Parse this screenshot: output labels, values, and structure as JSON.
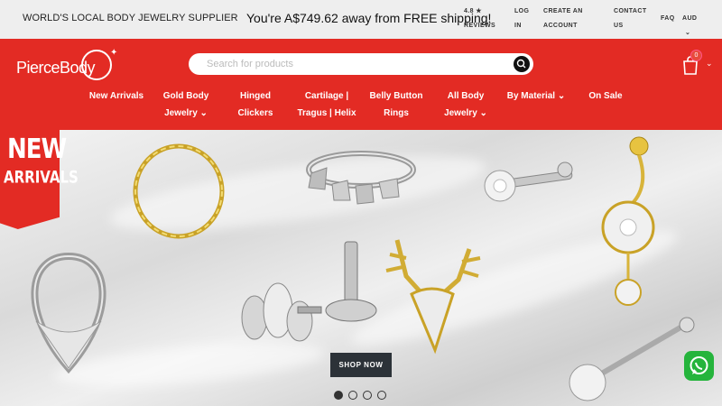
{
  "topbar": {
    "tagline": "WORLD'S LOCAL BODY JEWELRY SUPPLIER",
    "shipping_message": "You're A$749.62 away from FREE shipping!",
    "reviews": [
      "4.8 ★",
      "REVIEWS"
    ],
    "login": [
      "LOG",
      "IN"
    ],
    "create_account": [
      "CREATE AN",
      "ACCOUNT"
    ],
    "contact": [
      "CONTACT",
      "US"
    ],
    "faq": "FAQ",
    "currency": "AUD"
  },
  "header": {
    "logo_text": "PierceBody",
    "search_placeholder": "Search for products",
    "cart_count": "0"
  },
  "nav": [
    {
      "line1": "New Arrivals",
      "line2": ""
    },
    {
      "line1": "Gold Body",
      "line2": "Jewelry ⌄"
    },
    {
      "line1": "Hinged",
      "line2": "Clickers"
    },
    {
      "line1": "Cartilage |",
      "line2": "Tragus | Helix"
    },
    {
      "line1": "Belly Button",
      "line2": "Rings"
    },
    {
      "line1": "All Body",
      "line2": "Jewelry ⌄"
    },
    {
      "line1": "By Material ⌄",
      "line2": ""
    },
    {
      "line1": "On Sale",
      "line2": ""
    }
  ],
  "hero": {
    "badge_line1": "NEW",
    "badge_line2": "ARRIVALS",
    "cta": "SHOP NOW",
    "slides": 4,
    "active_slide": 1
  },
  "colors": {
    "brand_red": "#e32b24",
    "topbar_bg": "#eeeeee",
    "cta_bg": "#2c3238",
    "whatsapp": "#25b43c"
  }
}
